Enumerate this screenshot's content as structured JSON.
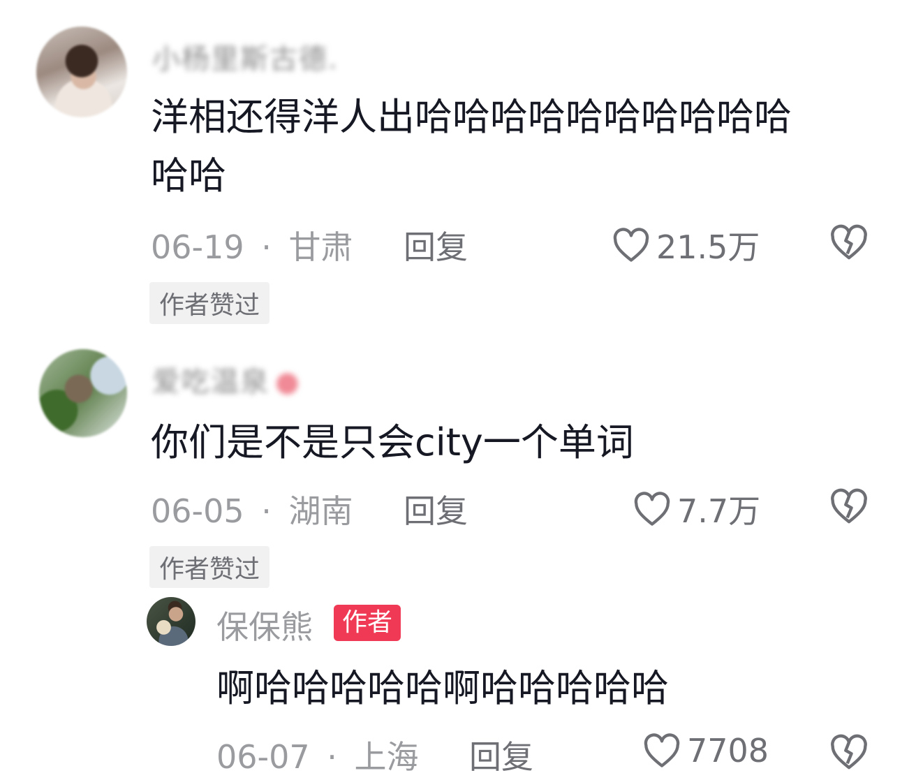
{
  "comments": [
    {
      "username": "小杨里斯古德.",
      "text_line1": "洋相还得洋人出哈哈哈哈哈哈哈哈哈哈",
      "text_line2": "哈哈",
      "date": "06-19",
      "location": "甘肃",
      "reply_label": "回复",
      "likes": "21.5万",
      "tag": "作者赞过"
    },
    {
      "username": "爱吃温泉",
      "text": "你们是不是只会city一个单词",
      "date": "06-05",
      "location": "湖南",
      "reply_label": "回复",
      "likes": "7.7万",
      "tag": "作者赞过",
      "reply": {
        "username": "保保熊",
        "badge": "作者",
        "text": "啊哈哈哈哈哈啊哈哈哈哈哈",
        "date": "06-07",
        "location": "上海",
        "reply_label": "回复",
        "likes": "7708"
      }
    }
  ],
  "separator": "·",
  "icons": {
    "like": "heart-outline-icon",
    "dislike": "broken-heart-icon"
  },
  "colors": {
    "author_badge": "#f03a55",
    "text": "#161823",
    "meta": "#9a9b9f"
  }
}
